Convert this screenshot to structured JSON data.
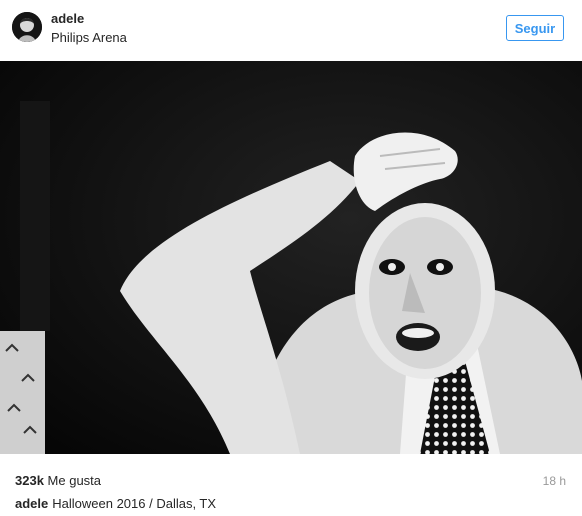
{
  "header": {
    "username": "adele",
    "location": "Philips Arena",
    "follow_label": "Seguir"
  },
  "post": {
    "image_alt": "Black and white photo of a person in a mask holding their forehead",
    "likes_count": "323k",
    "likes_label": "Me gusta",
    "time_ago": "18 h",
    "caption_user": "adele",
    "caption_text": "Halloween 2016 / Dallas, TX"
  },
  "colors": {
    "accent": "#3897f0",
    "text": "#262626",
    "muted": "#999999"
  }
}
